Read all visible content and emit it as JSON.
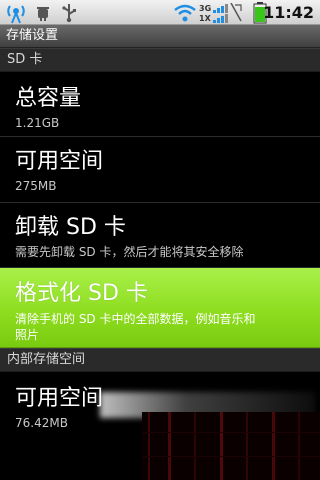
{
  "status_bar": {
    "icons": [
      "wifi-hotspot-icon",
      "android-debug-icon",
      "usb-icon",
      "wifi-signal-icon",
      "mobile-signal-icon",
      "battery-icon"
    ],
    "network_labels": [
      "3G",
      "1X"
    ],
    "time": "11:42"
  },
  "title_bar": {
    "title": "存储设置"
  },
  "sections": {
    "sd_card": {
      "header": "SD 卡",
      "items": [
        {
          "title": "总容量",
          "subtitle": "1.21GB"
        },
        {
          "title": "可用空间",
          "subtitle": "275MB"
        },
        {
          "title": "卸载 SD 卡",
          "subtitle": "需要先卸载 SD 卡，然后才能将其安全移除"
        },
        {
          "title": "格式化 SD 卡",
          "subtitle_line1": "清除手机的 SD 卡中的全部数据，例如音乐和",
          "subtitle_line2": "照片"
        }
      ]
    },
    "internal": {
      "header": "内部存储空间",
      "items": [
        {
          "title": "可用空间",
          "subtitle": "76.42MB"
        }
      ]
    }
  },
  "colors": {
    "highlight": "#8edd1f",
    "status_bar_bg": "#e6e6e6",
    "section_header_bg": "#2a2a2a",
    "wifi_icon": "#1f8fe6",
    "battery_fill": "#39c51a"
  }
}
